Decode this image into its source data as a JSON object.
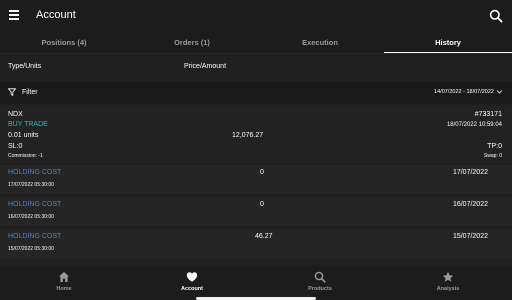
{
  "header": {
    "title": "Account"
  },
  "tabs": [
    {
      "label": "Positions (4)"
    },
    {
      "label": "Orders (1)"
    },
    {
      "label": "Execution"
    },
    {
      "label": "History",
      "active": true
    }
  ],
  "columns": {
    "type_units": "Type/Units",
    "price_amount": "Price/Amount"
  },
  "filter": {
    "label": "Filter",
    "date_range": "14/07/2022 - 18/07/2022"
  },
  "trade": {
    "symbol": "NDX",
    "id": "#733171",
    "type": "BUY TRADE",
    "datetime": "18/07/2022 10:59:04",
    "units": "0.01 units",
    "price": "12,076.27",
    "sl": "SL:0",
    "tp": "TP:0",
    "commission": "Commission: -1",
    "swap": "Swap: 0"
  },
  "holdings": [
    {
      "label": "HOLDING COST",
      "value": "0",
      "date": "17/07/2022",
      "timestamp": "17/07/2022 05:30:00"
    },
    {
      "label": "HOLDING COST",
      "value": "0",
      "date": "16/07/2022",
      "timestamp": "16/07/2022 05:30:00"
    },
    {
      "label": "HOLDING COST",
      "value": "46.27",
      "date": "15/07/2022",
      "timestamp": "15/07/2022 05:30:00"
    }
  ],
  "nav": [
    {
      "label": "Home",
      "icon": "home-icon"
    },
    {
      "label": "Account",
      "icon": "heart-icon",
      "active": true
    },
    {
      "label": "Products",
      "icon": "search-icon"
    },
    {
      "label": "Analysis",
      "icon": "star-icon"
    }
  ],
  "colors": {
    "buy": "#35b6c6",
    "holding": "#4d82c6",
    "background": "#202020"
  }
}
